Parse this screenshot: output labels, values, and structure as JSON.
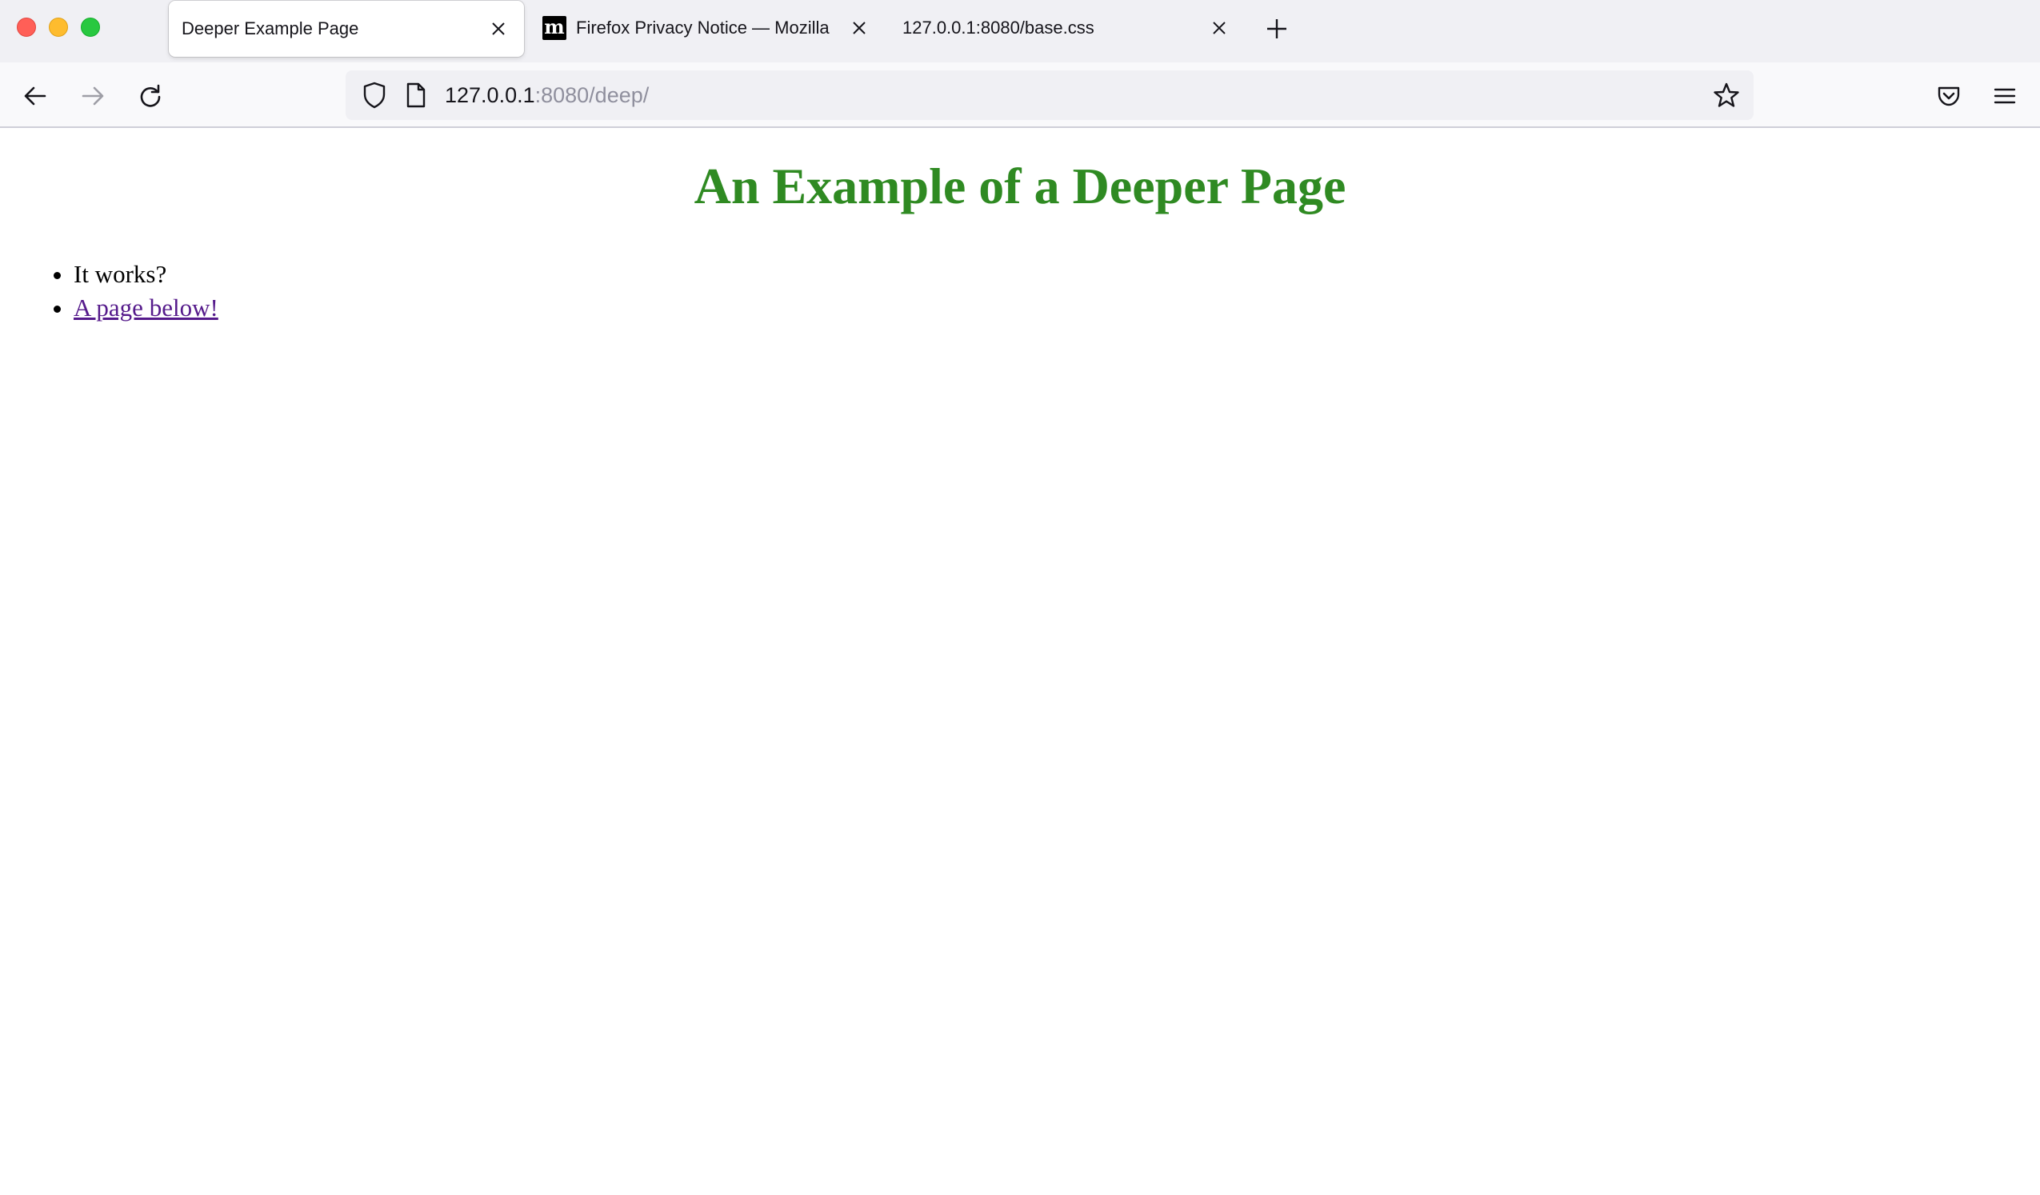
{
  "browser": {
    "tabs": [
      {
        "title": "Deeper Example Page",
        "active": true,
        "favicon": "none"
      },
      {
        "title": "Firefox Privacy Notice — Mozilla",
        "active": false,
        "favicon": "mozilla-m-icon",
        "favicon_glyph": "m"
      },
      {
        "title": "127.0.0.1:8080/base.css",
        "active": false,
        "favicon": "none"
      }
    ],
    "url": {
      "host": "127.0.0.1",
      "rest": ":8080/deep/"
    }
  },
  "page": {
    "heading": "An Example of a Deeper Page",
    "items": [
      {
        "text": "It works?",
        "link": false
      },
      {
        "text": "A page below!",
        "link": true
      }
    ]
  },
  "colors": {
    "heading": "#2f8a22",
    "visited_link": "#551a8b",
    "tabstrip_bg": "#f0f0f4",
    "toolbar_bg": "#f9f9fb"
  }
}
